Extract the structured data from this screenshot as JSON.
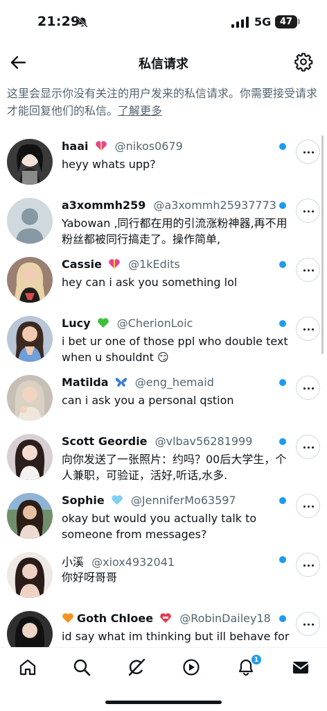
{
  "status": {
    "time": "21:29",
    "network": "5G",
    "battery": "47"
  },
  "header": {
    "title": "私信请求"
  },
  "intro": {
    "text": "这里会显示你没有关注的用户发来的私信请求。你需要接受请求才能回复他们的私信。",
    "link": "了解更多"
  },
  "requests": [
    {
      "name": "haai",
      "emoji": "heart-gift",
      "handle": "@nikos0679",
      "message": "heyy whats upp?",
      "unread": true
    },
    {
      "name": "a3xommh259",
      "emoji": "",
      "handle": "@a3xommh25937773",
      "message": "Yabowan ,同行都在用的引流涨粉神器,再不用粉丝都被同行搞走了。操作简单,",
      "unread": true
    },
    {
      "name": "Cassie",
      "emoji": "heart-gift",
      "handle": "@1kEdits",
      "message": "hey can i ask you something lol",
      "unread": true
    },
    {
      "name": "Lucy",
      "emoji": "green-heart",
      "handle": "@CherionLoic",
      "message": "i bet ur one of those ppl who double text when u shouldnt 😏",
      "unread": true
    },
    {
      "name": "Matilda",
      "emoji": "butterfly",
      "handle": "@eng_hemaid",
      "message": "can i ask you a personal qstion",
      "unread": true
    },
    {
      "name": "Scott Geordie",
      "emoji": "",
      "handle": "@vlbav56281999",
      "message": "向你发送了一张照片：约吗？00后大学生，个人兼职，可验证，活好,听话,水多.",
      "unread": true
    },
    {
      "name": "Sophie",
      "emoji": "light-blue-heart",
      "handle": "@JenniferMo63597",
      "message": "okay but would you actually talk to someone from messages?",
      "unread": true
    },
    {
      "name": "小溪",
      "emoji": "",
      "handle": "@xiox4932041",
      "message": "你好呀哥哥",
      "unread": true
    },
    {
      "name": "Goth Chloee",
      "emoji": "mending-heart",
      "handle": "@RobinDailey18",
      "message": "id say what im thinking but ill behave for",
      "unread": true
    }
  ],
  "tabbar": {
    "items": [
      "home-icon",
      "search-icon",
      "grok-icon",
      "video-icon",
      "notifications-icon",
      "messages-icon"
    ],
    "notifications_badge": "1"
  },
  "colors": {
    "accent": "#1d9bf0",
    "text": "#0f1419",
    "muted": "#536471"
  }
}
